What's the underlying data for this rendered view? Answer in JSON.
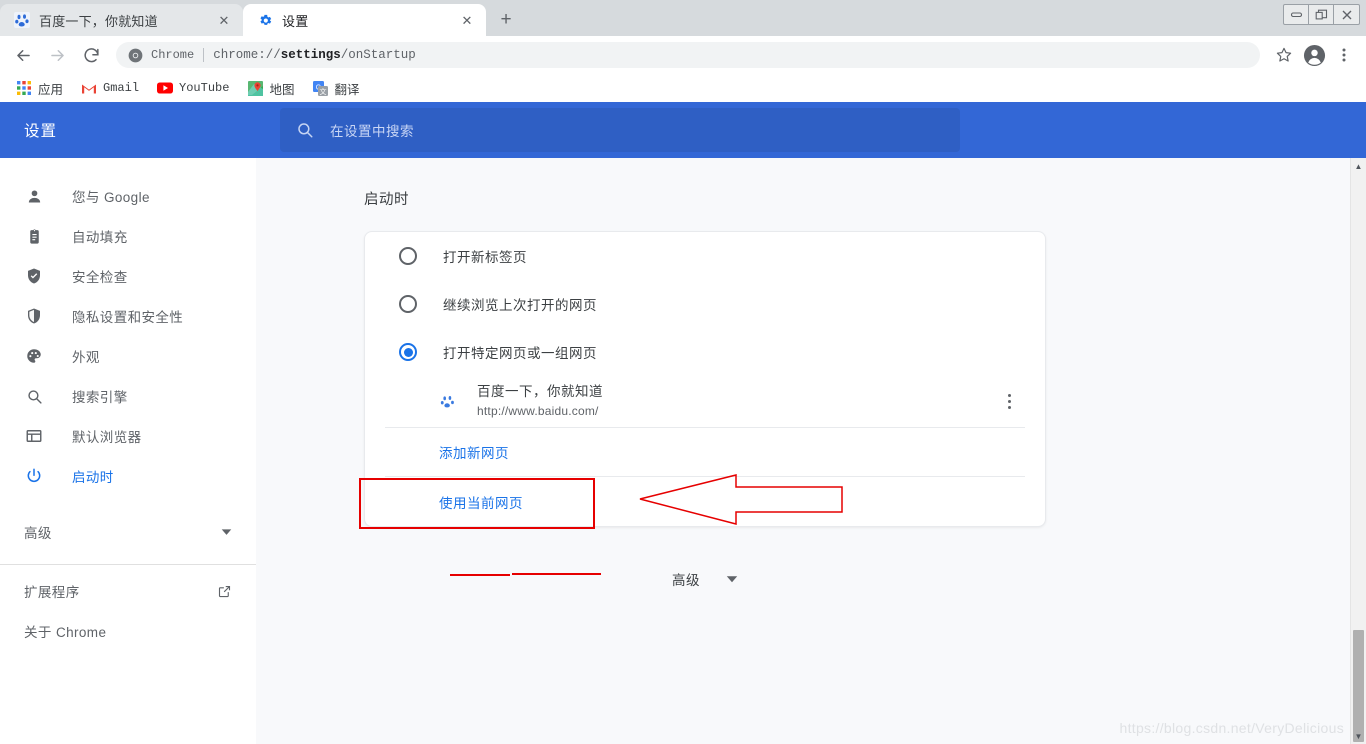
{
  "window": {
    "controls": [
      {
        "name": "minimize",
        "glyph": "—"
      },
      {
        "name": "restore",
        "glyph": "❐"
      },
      {
        "name": "close",
        "glyph": "✕"
      }
    ]
  },
  "tabs": [
    {
      "title": "百度一下，你就知道",
      "favicon": "baidu-icon",
      "active": false,
      "close_label": "✕"
    },
    {
      "title": "设置",
      "favicon": "gear-icon",
      "active": true,
      "close_label": "✕"
    }
  ],
  "newtab_label": "+",
  "toolbar": {
    "back_label": "←",
    "forward_label": "→",
    "reload_label": "⟳",
    "chrome_chip": "Chrome",
    "url_prefix": "chrome://",
    "url_bold": "settings",
    "url_suffix": "/onStartup",
    "bookmark_star": "☆",
    "profile_icon": "avatar-icon",
    "menu_icon": "three-dot-menu-icon"
  },
  "bookmarks": [
    {
      "label": "应用",
      "icon": "apps-grid-icon",
      "cjk": true
    },
    {
      "label": "Gmail",
      "icon": "gmail-icon",
      "cjk": false
    },
    {
      "label": "YouTube",
      "icon": "youtube-icon",
      "cjk": false
    },
    {
      "label": "地图",
      "icon": "maps-icon",
      "cjk": true
    },
    {
      "label": "翻译",
      "icon": "translate-icon",
      "cjk": true
    }
  ],
  "settings": {
    "title": "设置",
    "search_placeholder": "在设置中搜索",
    "search_icon": "search-icon",
    "header_color": "#3367d6",
    "accent_color": "#1a73e8"
  },
  "sidebar": {
    "items": [
      {
        "label": "您与 Google",
        "icon": "person-icon",
        "active": false
      },
      {
        "label": "自动填充",
        "icon": "clipboard-icon",
        "active": false
      },
      {
        "label": "安全检查",
        "icon": "shield-check-icon",
        "active": false
      },
      {
        "label": "隐私设置和安全性",
        "icon": "shield-icon",
        "active": false
      },
      {
        "label": "外观",
        "icon": "palette-icon",
        "active": false
      },
      {
        "label": "搜索引擎",
        "icon": "search-icon",
        "active": false
      },
      {
        "label": "默认浏览器",
        "icon": "browser-window-icon",
        "active": false
      },
      {
        "label": "启动时",
        "icon": "power-icon",
        "active": true
      }
    ],
    "advanced_label": "高级",
    "advanced_icon": "chevron-down-icon",
    "footer": [
      {
        "label": "扩展程序",
        "icon": "external-link-icon"
      },
      {
        "label": "关于 Chrome",
        "icon": ""
      }
    ]
  },
  "main": {
    "section_title": "启动时",
    "options": [
      {
        "label": "打开新标签页",
        "checked": false
      },
      {
        "label": "继续浏览上次打开的网页",
        "checked": false
      },
      {
        "label": "打开特定网页或一组网页",
        "checked": true
      }
    ],
    "site": {
      "name": "百度一下，你就知道",
      "url": "http://www.baidu.com/",
      "favicon": "baidu-icon",
      "menu_icon": "kebab-menu-icon"
    },
    "add_page_label": "添加新网页",
    "use_current_label": "使用当前网页",
    "advanced_toggle_label": "高级",
    "advanced_toggle_icon": "chevron-down-icon"
  },
  "annotations": {
    "color": "#e60000",
    "highlight_target": "打开特定网页或一组网页",
    "arrow_direction": "left",
    "underline_target": "http://www.baidu.com/"
  },
  "scrollbar": {
    "up_glyph": "▲",
    "down_glyph": "▼"
  },
  "watermark": "https://blog.csdn.net/VeryDelicious"
}
